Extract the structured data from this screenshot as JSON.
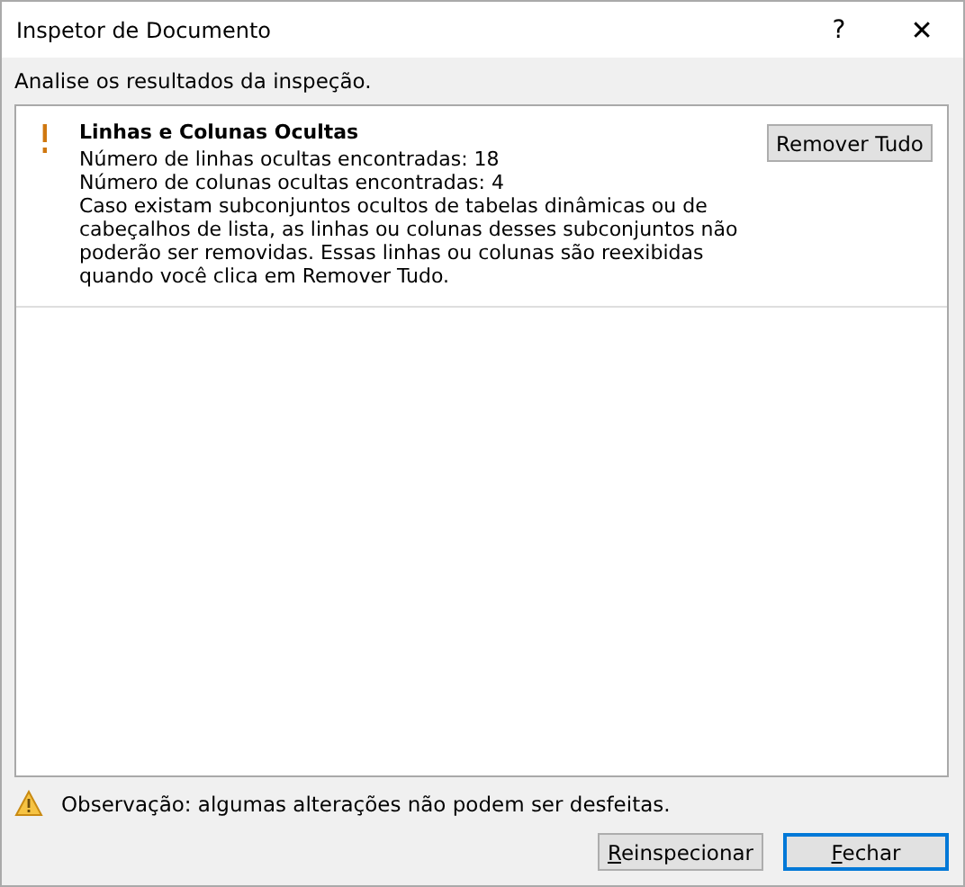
{
  "window": {
    "title": "Inspetor de Documento",
    "help": "?",
    "close": "✕"
  },
  "instruction": "Analise os resultados da inspeção.",
  "results": [
    {
      "kind": "warning",
      "title": "Linhas e Colunas Ocultas",
      "lines": [
        "Número de linhas ocultas encontradas: 18",
        "Número de colunas ocultas encontradas: 4",
        "Caso existam subconjuntos ocultos de tabelas dinâmicas ou de cabeçalhos de lista, as linhas ou colunas desses subconjuntos não poderão ser removidas. Essas linhas ou colunas são reexibidas quando você clica em Remover Tudo."
      ],
      "action": "Remover Tudo"
    }
  ],
  "note": "Observação: algumas alterações não podem ser desfeitas.",
  "buttons": [
    {
      "mnemonic": "R",
      "rest": "einspecionar",
      "default": false
    },
    {
      "mnemonic": "F",
      "rest": "echar",
      "default": true
    }
  ]
}
